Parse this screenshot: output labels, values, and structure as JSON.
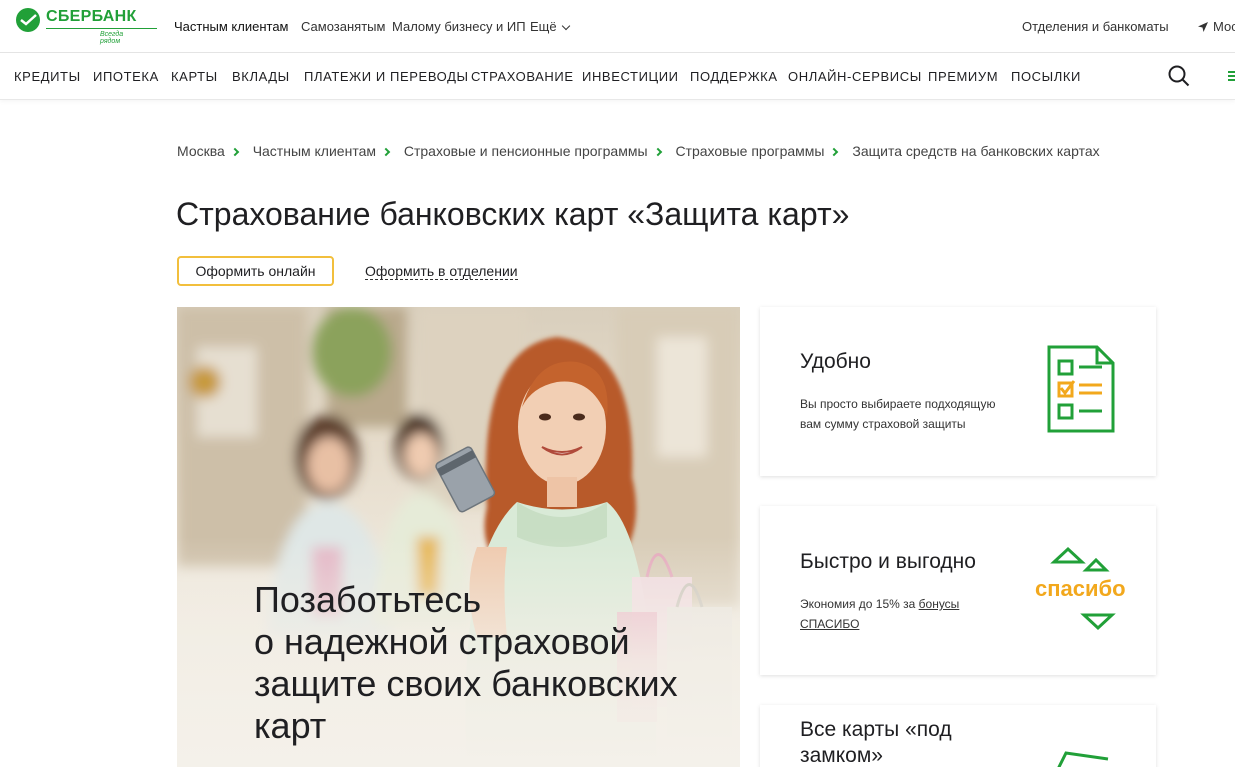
{
  "brand": {
    "name": "СБЕРБАНК",
    "slogan": "Всегда рядом",
    "green": "#21a038"
  },
  "segments": [
    {
      "label": "Частным клиентам",
      "active": true
    },
    {
      "label": "Самозанятым"
    },
    {
      "label": "Малому бизнесу и ИП"
    },
    {
      "label": "Ещё"
    }
  ],
  "top_right": {
    "branches": "Отделения и банкоматы",
    "city": "Мос"
  },
  "nav": [
    "КРЕДИТЫ",
    "ИПОТЕКА",
    "КАРТЫ",
    "ВКЛАДЫ",
    "ПЛАТЕЖИ И ПЕРЕВОДЫ",
    "СТРАХОВАНИЕ",
    "ИНВЕСТИЦИИ",
    "ПОДДЕРЖКА",
    "ОНЛАЙН-СЕРВИСЫ",
    "ПРЕМИУМ",
    "ПОСЫЛКИ"
  ],
  "breadcrumbs": [
    "Москва",
    "Частным клиентам",
    "Страховые и пенсионные программы",
    "Страховые программы",
    "Защита средств на банковских картах"
  ],
  "page": {
    "title": "Страхование банковских карт «Защита карт»",
    "btn_online": "Оформить онлайн",
    "link_office": "Оформить в отделении"
  },
  "hero": {
    "lines": [
      "Позаботьтесь",
      "о надежной страховой",
      "защите своих банковских",
      "карт"
    ]
  },
  "cards": [
    {
      "title": "Удобно",
      "text1": "Вы просто выбираете подходящую",
      "text2": "вам сумму страховой защиты",
      "icon": "checklist-icon"
    },
    {
      "title": "Быстро и выгодно",
      "text1": "Экономия до 15% за ",
      "link1": "бонусы",
      "link2": "СПАСИБО",
      "icon": "spasibo-icon",
      "icon_text": "спасибо"
    },
    {
      "title1": "Все карты «под",
      "title2": "замком»",
      "icon": "lock-icon"
    }
  ],
  "colors": {
    "accent_yellow": "#f2bf3c",
    "spasibo_orange": "#f2a81d"
  }
}
